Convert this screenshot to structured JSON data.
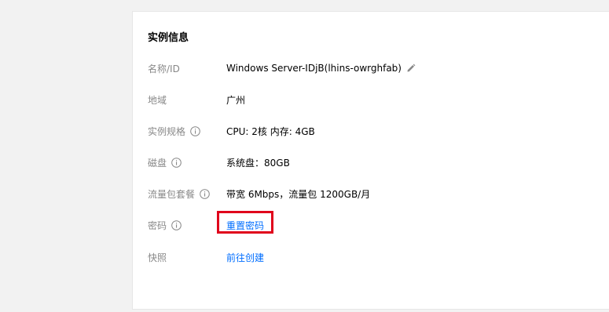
{
  "panel": {
    "title": "实例信息",
    "rows": {
      "name": {
        "label": "名称/ID",
        "value": "Windows Server-IDjB(lhins-owrghfab)"
      },
      "region": {
        "label": "地域",
        "value": "广州"
      },
      "spec": {
        "label": "实例规格",
        "value": "CPU: 2核 内存: 4GB"
      },
      "disk": {
        "label": "磁盘",
        "value": "系统盘：80GB"
      },
      "traffic": {
        "label": "流量包套餐",
        "value": "带宽 6Mbps，流量包 1200GB/月"
      },
      "password": {
        "label": "密码",
        "link": "重置密码"
      },
      "snapshot": {
        "label": "快照",
        "link": "前往创建"
      }
    }
  },
  "colors": {
    "link": "#006eff",
    "highlight": "#e0001b",
    "label": "#888888"
  },
  "icons": [
    "info-icon",
    "pencil-icon"
  ]
}
